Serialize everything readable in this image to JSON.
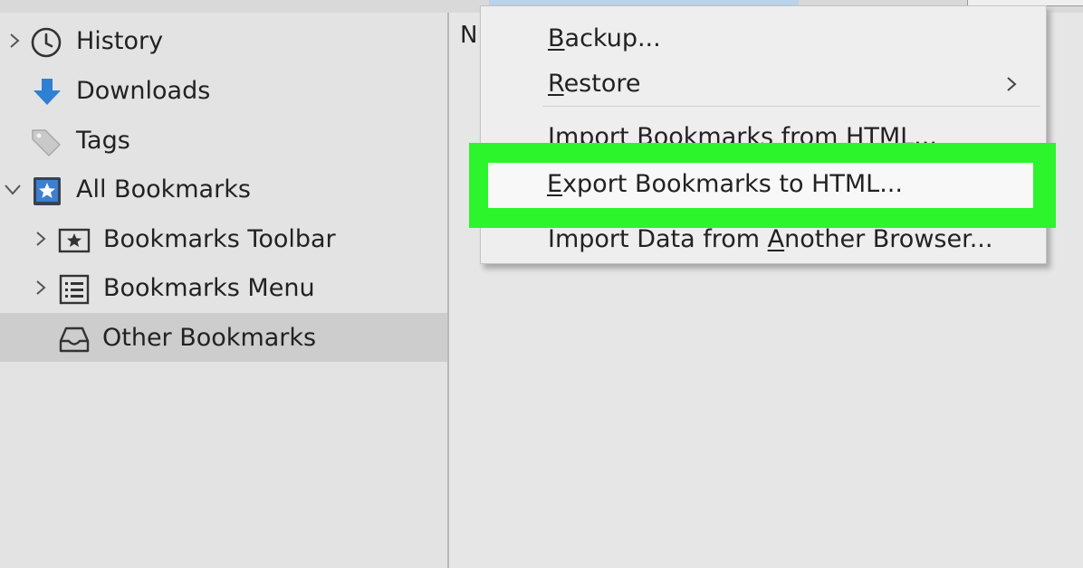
{
  "sidebar": {
    "items": [
      {
        "label": "History",
        "icon": "clock-icon",
        "twisty": "collapsed"
      },
      {
        "label": "Downloads",
        "icon": "download-arrow-icon",
        "twisty": "none"
      },
      {
        "label": "Tags",
        "icon": "tag-icon",
        "twisty": "none"
      },
      {
        "label": "All Bookmarks",
        "icon": "bookmarks-library-icon",
        "twisty": "expanded"
      },
      {
        "label": "Bookmarks Toolbar",
        "icon": "star-toolbar-icon",
        "twisty": "collapsed"
      },
      {
        "label": "Bookmarks Menu",
        "icon": "list-menu-icon",
        "twisty": "collapsed"
      },
      {
        "label": "Other Bookmarks",
        "icon": "tray-icon",
        "twisty": "none",
        "selected": true
      }
    ]
  },
  "main": {
    "column_header_fragment": "N"
  },
  "menu": {
    "backup": {
      "underline": "B",
      "rest": "ackup..."
    },
    "restore": {
      "underline": "R",
      "rest": "estore"
    },
    "import_html": "Import Bookmarks from HTML...",
    "export_html": {
      "underline": "E",
      "rest": "xport Bookmarks to HTML..."
    },
    "import_browser": {
      "before": "Import Data from ",
      "underline": "A",
      "after": "nother Browser..."
    }
  },
  "colors": {
    "highlight": "#2cf52b",
    "selection": "#cdcdcd",
    "download_blue": "#2f7fd3"
  }
}
